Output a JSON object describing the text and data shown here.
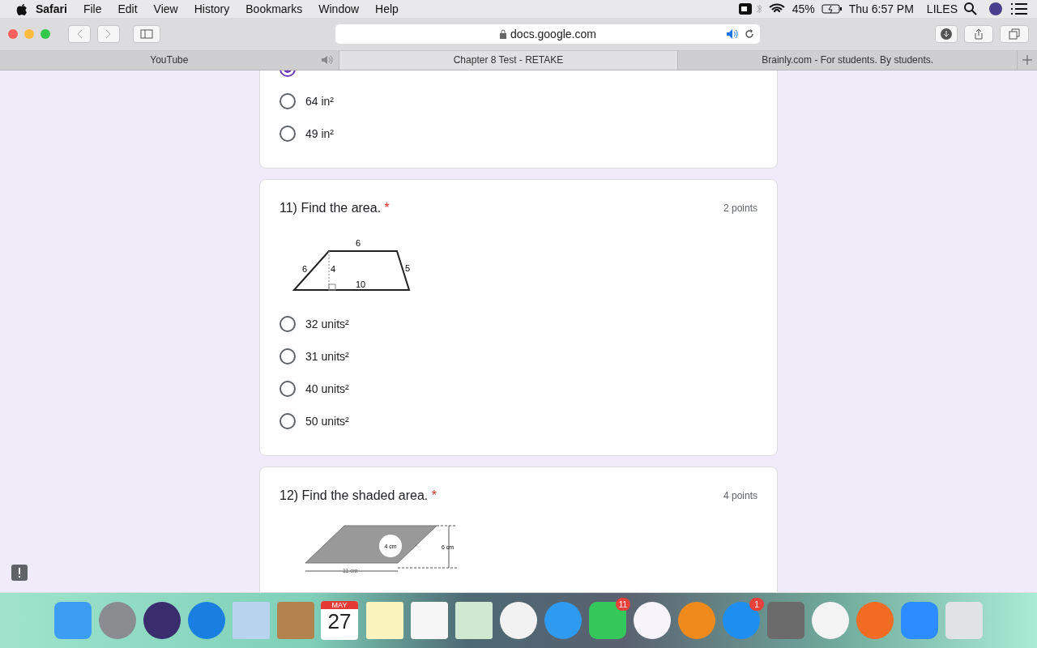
{
  "menu_bar": {
    "app": "Safari",
    "items": [
      "File",
      "Edit",
      "View",
      "History",
      "Bookmarks",
      "Window",
      "Help"
    ],
    "battery": "45%",
    "clock": "Thu 6:57 PM",
    "user": "LILES"
  },
  "toolbar": {
    "address": "docs.google.com"
  },
  "tabs": [
    {
      "label": "YouTube",
      "selected": false,
      "audio": true
    },
    {
      "label": "Chapter 8 Test - RETAKE",
      "selected": true,
      "audio": false
    },
    {
      "label": "Brainly.com - For students. By students.",
      "selected": false,
      "audio": false
    }
  ],
  "questions": [
    {
      "kind": "choice",
      "options": [
        {
          "selected": true
        },
        {
          "label": "64 in²",
          "selected": false
        },
        {
          "label": "49 in²",
          "selected": false
        }
      ]
    },
    {
      "kind": "trapezoid",
      "title": "11) Find the area.",
      "required": "*",
      "points": "2 points",
      "figure_labels": [
        "6",
        "6",
        "4",
        "5",
        "10"
      ],
      "options": [
        {
          "label": "32 units²",
          "selected": false
        },
        {
          "label": "31 units²",
          "selected": false
        },
        {
          "label": "40 units²",
          "selected": false
        },
        {
          "label": "50 units²",
          "selected": false
        }
      ]
    },
    {
      "kind": "parallelogram",
      "title": "12) Find the shaded area.",
      "required": "*",
      "points": "4 points",
      "figure_labels": [
        "4 cm",
        "6 cm",
        "11 cm"
      ]
    }
  ],
  "dock": {
    "calendar": {
      "month": "MAY",
      "day": "27"
    },
    "badges": [
      "11",
      "1"
    ]
  }
}
